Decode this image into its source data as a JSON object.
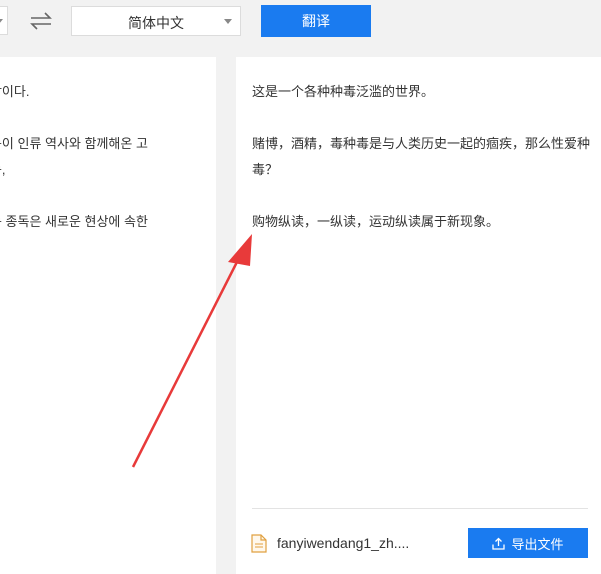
{
  "toolbar": {
    "target_language": "简体中文",
    "translate_label": "翻译"
  },
  "source_panel": {
    "lines": [
      "세상이다.",
      "",
      "종독이 인류 역사와 함께해온 고",
      "종독,",
      "",
      "운동 종독은 새로운 현상에 속한"
    ]
  },
  "target_panel": {
    "lines": [
      "这是一个各种种毒泛滥的世界。",
      "",
      "赌博，酒精，毒种毒是与人类历史一起的痼疾，那么性爱种毒？",
      "",
      "购物纵读，一纵读，运动纵读属于新现象。"
    ]
  },
  "footer": {
    "file_name": "fanyiwendang1_zh....",
    "export_label": "导出文件"
  },
  "icons": {
    "swap": "swap-arrows-icon",
    "file": "document-icon",
    "export": "upload-icon"
  },
  "colors": {
    "accent": "#1a7bf0",
    "annotation": "#e83a3a"
  }
}
